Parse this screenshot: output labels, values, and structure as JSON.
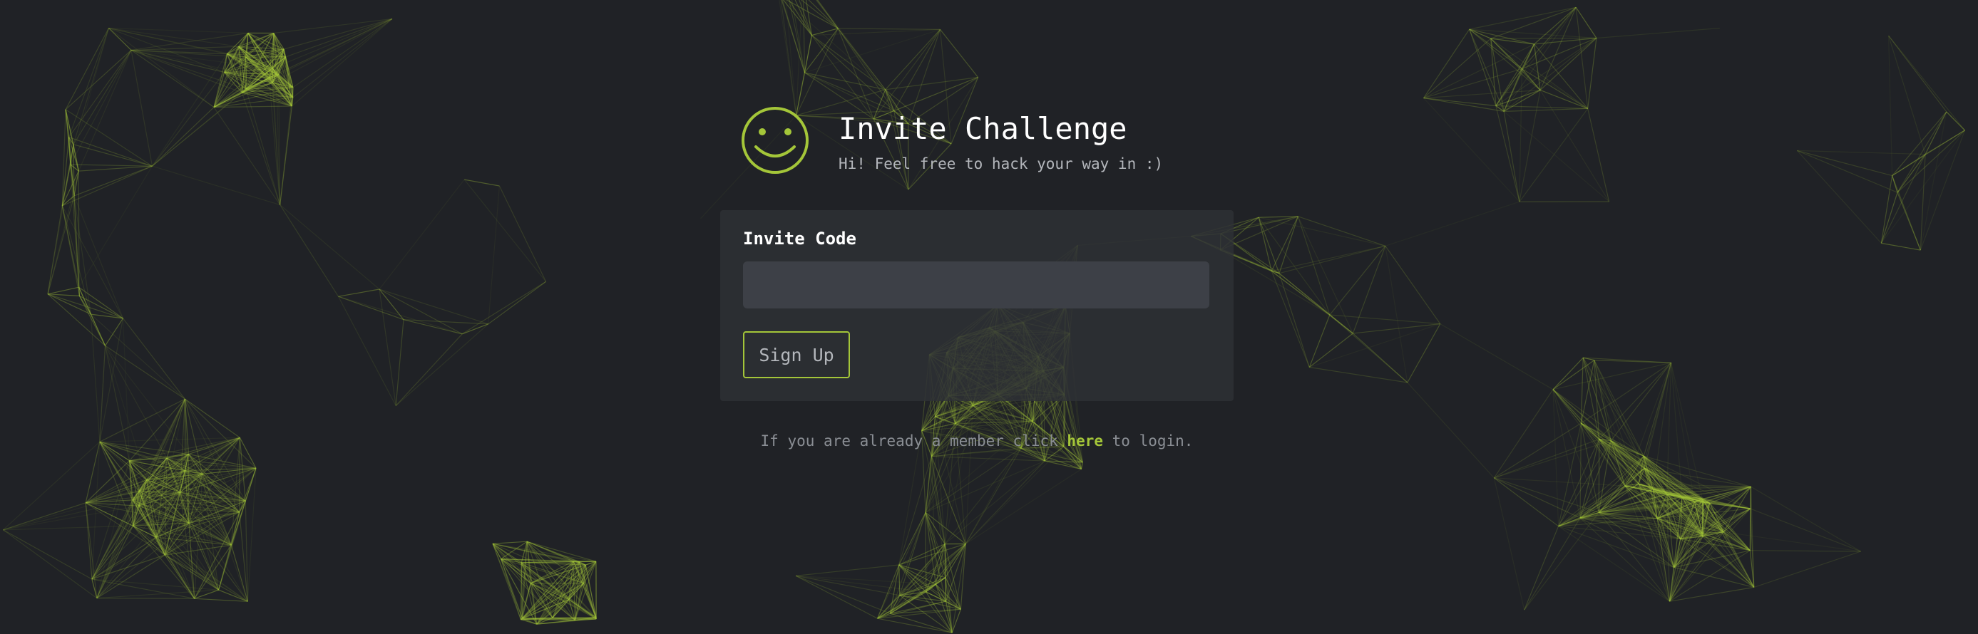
{
  "header": {
    "title": "Invite Challenge",
    "subtitle": "Hi! Feel free to hack your way in :)",
    "logo_icon": "smiley-face-icon"
  },
  "form": {
    "invite_code_label": "Invite Code",
    "invite_code_value": "",
    "invite_code_placeholder": "",
    "submit_label": "Sign Up"
  },
  "footer": {
    "prefix": "If you are already a member click",
    "link_label": "here",
    "suffix": "to login."
  },
  "colors": {
    "background": "#202226",
    "accent": "#a4c639",
    "card": "#2e3136",
    "input": "#3d4047",
    "muted_text": "#8a8e94"
  }
}
